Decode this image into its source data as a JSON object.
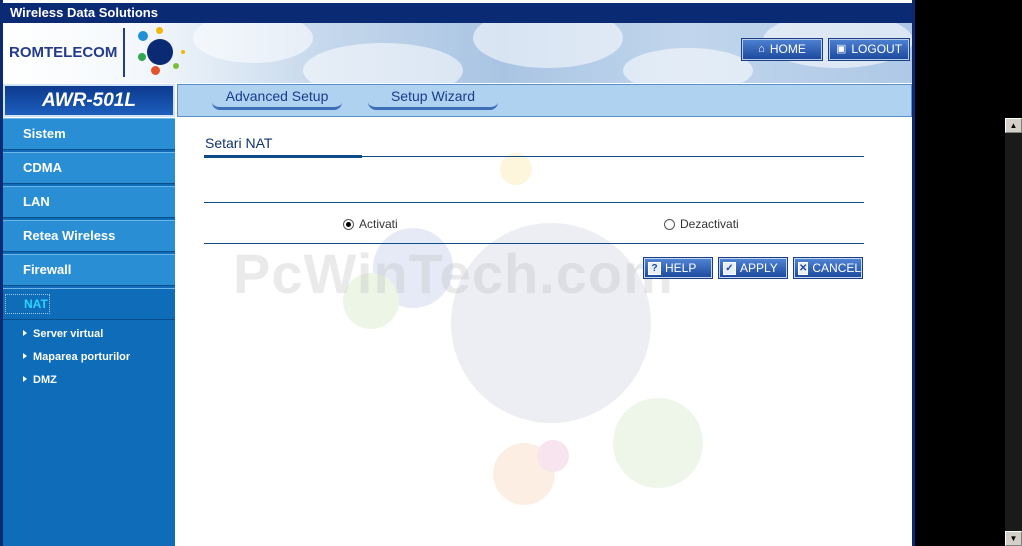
{
  "window": {
    "title": "Wireless Data Solutions"
  },
  "header": {
    "brand": "ROMTELECOM",
    "home_label": "HOME",
    "logout_label": "LOGOUT"
  },
  "model": "AWR-501L",
  "tabs": [
    {
      "label": "Advanced Setup"
    },
    {
      "label": "Setup Wizard"
    }
  ],
  "sidebar": {
    "items": [
      {
        "label": "Sistem"
      },
      {
        "label": "CDMA"
      },
      {
        "label": "LAN"
      },
      {
        "label": "Retea Wireless"
      },
      {
        "label": "Firewall"
      },
      {
        "label": "NAT",
        "active": true
      }
    ],
    "subitems": [
      {
        "label": "Server virtual"
      },
      {
        "label": "Maparea porturilor"
      },
      {
        "label": "DMZ"
      }
    ]
  },
  "main": {
    "section_title": "Setari NAT",
    "watermark": "PcWinTech.com",
    "options": [
      {
        "label": "Activati",
        "selected": true
      },
      {
        "label": "Dezactivati",
        "selected": false
      }
    ],
    "buttons": {
      "help": "HELP",
      "apply": "APPLY",
      "cancel": "CANCEL"
    }
  },
  "colors": {
    "frame": "#0b2a74",
    "sidebar": "#0e6cb8",
    "menu_item": "#2a8ed4",
    "active_text": "#2ad4ff",
    "tab_bar": "#aed2ef"
  }
}
